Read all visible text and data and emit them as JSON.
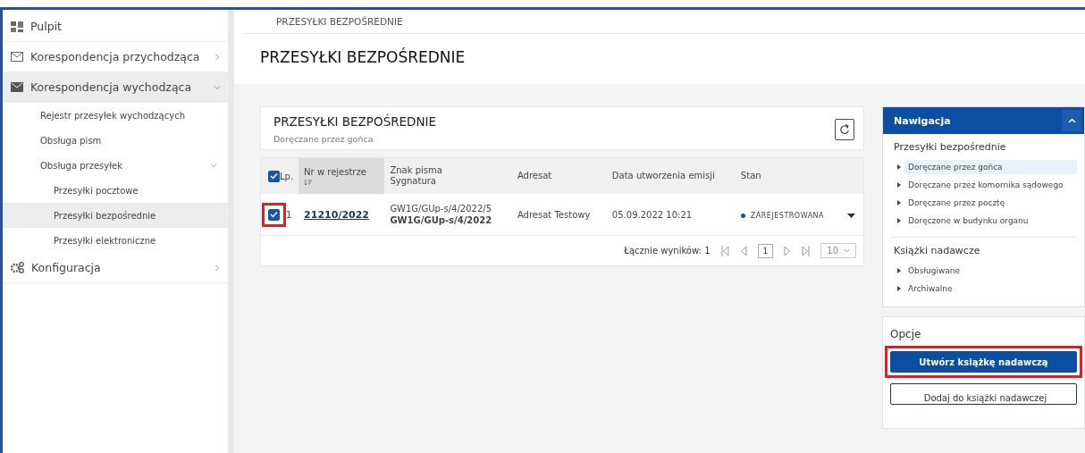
{
  "sidebar": {
    "items": [
      {
        "label": "Pulpit",
        "kind": "link"
      },
      {
        "label": "Korespondencja przychodząca",
        "kind": "group",
        "expanded": false
      },
      {
        "label": "Korespondencja wychodząca",
        "kind": "group",
        "expanded": true,
        "children": [
          {
            "label": "Rejestr przesyłek wychodzących",
            "selected": false
          },
          {
            "label": "Obsługa pism",
            "selected": false
          },
          {
            "label": "Obsługa przesyłek",
            "expanded": true,
            "selected": false,
            "children": [
              {
                "label": "Przesyłki pocztowe",
                "selected": false
              },
              {
                "label": "Przesyłki bezpośrednie",
                "selected": true
              },
              {
                "label": "Przesyłki elektroniczne",
                "selected": false
              }
            ]
          }
        ]
      },
      {
        "label": "Konfiguracja",
        "kind": "group",
        "expanded": false
      }
    ]
  },
  "breadcrumb": "PRZESYŁKI BEZPOŚREDNIE",
  "page_title": "PRZESYŁKI BEZPOŚREDNIE",
  "card": {
    "title": "PRZESYŁKI BEZPOŚREDNIE",
    "subtitle": "Doręczane przez gońca",
    "table": {
      "all_checked": true,
      "columns": [
        {
          "label": "Lp.",
          "sorted": false
        },
        {
          "label": "Nr w rejestrze",
          "sorted": true
        },
        {
          "label": "Znak pisma",
          "label2": "Sygnatura",
          "sorted": false
        },
        {
          "label": "Adresat",
          "sorted": false
        },
        {
          "label": "Data utworzenia emisji",
          "sorted": false
        },
        {
          "label": "Stan",
          "sorted": false
        }
      ],
      "rows": [
        {
          "checked": true,
          "highlighted": true,
          "lp": "1",
          "number": "21210/2022",
          "sign": "GW1G/GUp-s/4/2022/5",
          "signature": "GW1G/GUp-s/4/2022",
          "addressee": "Adresat Testowy",
          "date": "05.09.2022 10:21",
          "status": "ZAREJESTROWANA",
          "color": "#0b4ea2"
        }
      ]
    },
    "total": "Łącznie wyników: 1",
    "page": "1",
    "page_size": "10"
  },
  "navigation": {
    "title": "Nawigacja",
    "expanded": true,
    "sections": [
      {
        "title": "Przesyłki bezpośrednie",
        "items": [
          {
            "label": "Doręczane przez gońca",
            "selected": true
          },
          {
            "label": "Doręczane przez komornika sądowego",
            "selected": false
          },
          {
            "label": "Doręczane przez pocztę",
            "selected": false
          },
          {
            "label": "Doręczone w budynku organu",
            "selected": false
          }
        ]
      },
      {
        "title": "Książki nadawcze",
        "items": [
          {
            "label": "Obsługiwane",
            "selected": false
          },
          {
            "label": "Archiwalne",
            "selected": false
          }
        ]
      }
    ]
  },
  "options": {
    "title": "Opcje",
    "buttons": [
      {
        "label": "Utwórz książkę nadawczą",
        "kind": "primary",
        "highlighted": true
      },
      {
        "label": "Dodaj do książki nadawczej",
        "kind": "secondary",
        "highlighted": false
      }
    ]
  }
}
